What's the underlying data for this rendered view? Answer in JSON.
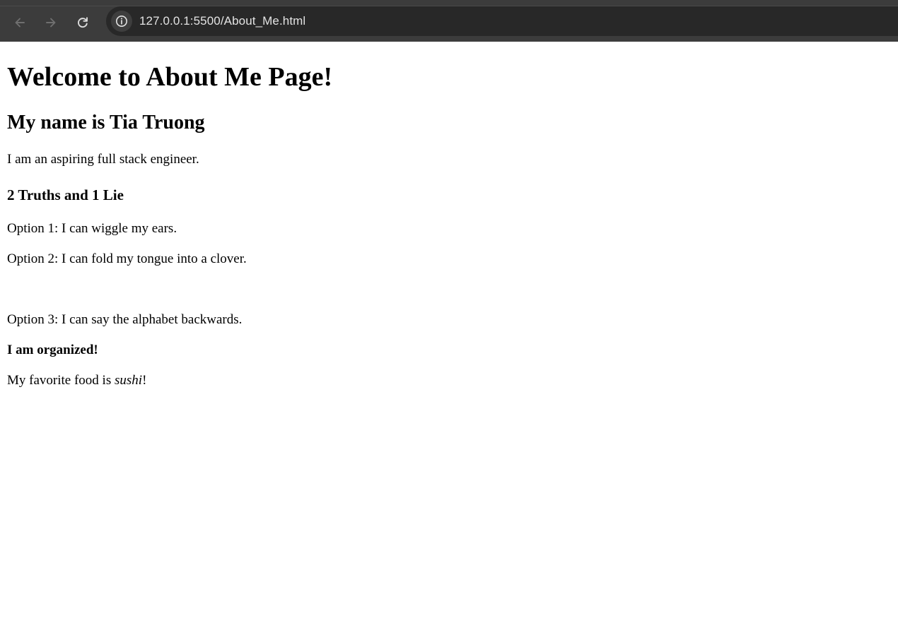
{
  "browser": {
    "url": "127.0.0.1:5500/About_Me.html",
    "icons": {
      "back": "arrow-left-icon",
      "forward": "arrow-right-icon",
      "reload": "reload-icon",
      "site_info": "info-icon"
    },
    "colors": {
      "chrome": "#3c3c3c",
      "address_bar": "#282828",
      "url_text": "#e3e3e3"
    }
  },
  "page": {
    "heading": "Welcome to About Me Page!",
    "name_heading": "My name is Tia Truong",
    "intro": "I am an aspiring full stack engineer.",
    "game_heading": "2 Truths and 1 Lie",
    "option1": "Option 1: I can wiggle my ears.",
    "option2": "Option 2: I can fold my tongue into a clover.",
    "option3": "Option 3: I can say the alphabet backwards.",
    "organized": "I am organized!",
    "food_prefix": "My favorite food is ",
    "food_item": "sushi",
    "food_suffix": "!"
  }
}
